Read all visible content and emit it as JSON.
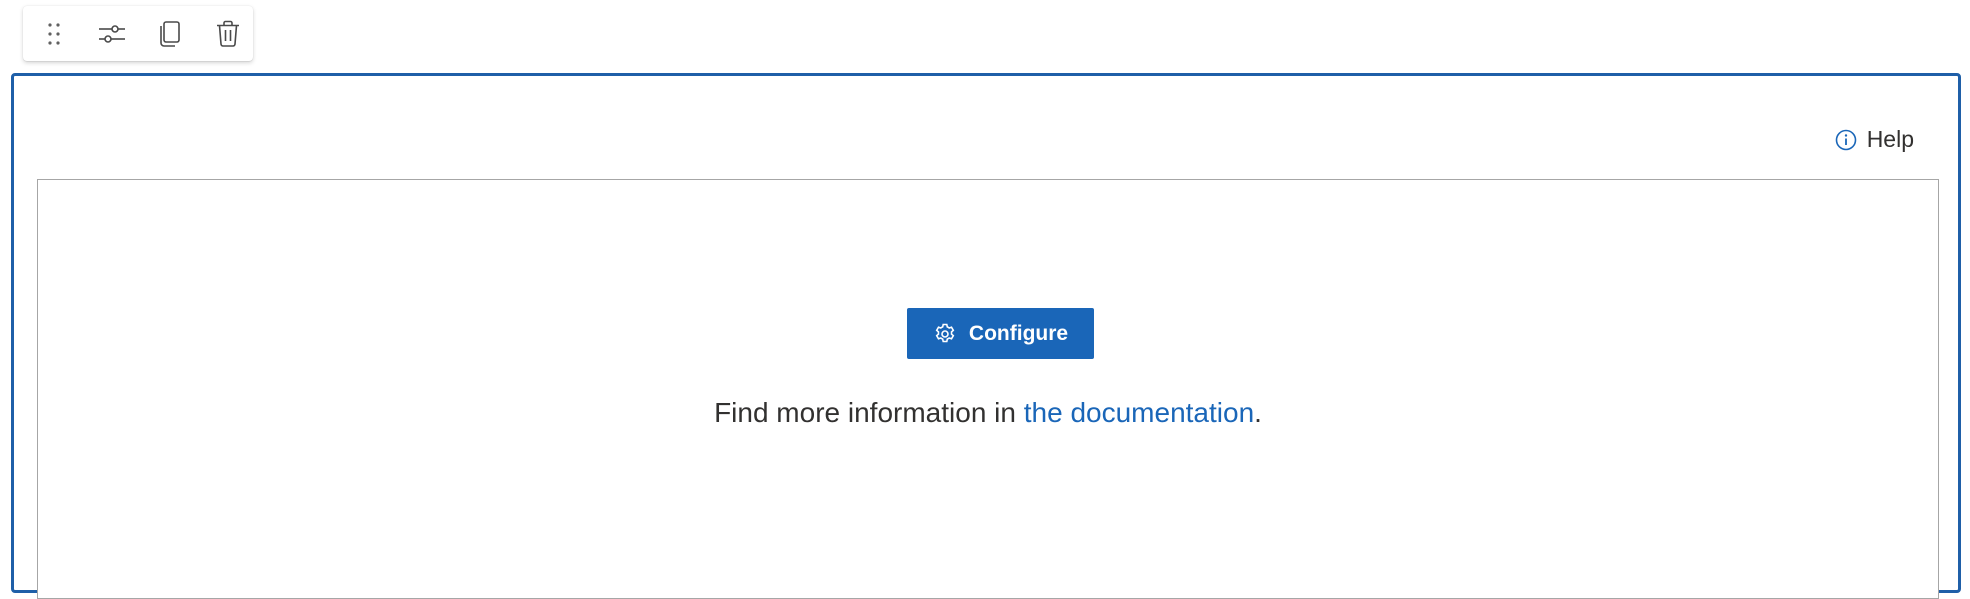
{
  "toolbar": {
    "items": [
      {
        "icon": "drag-handle-icon"
      },
      {
        "icon": "edit-properties-icon"
      },
      {
        "icon": "duplicate-icon"
      },
      {
        "icon": "delete-icon"
      }
    ]
  },
  "webpart": {
    "help_label": "Help",
    "configure_label": "Configure",
    "info_prefix": "Find more information in ",
    "info_link": "the documentation",
    "info_suffix": "."
  },
  "colors": {
    "accent": "#1a66b8",
    "selection_border": "#1f5fa8",
    "text": "#323130",
    "canvas_border": "#a6a6a6"
  }
}
